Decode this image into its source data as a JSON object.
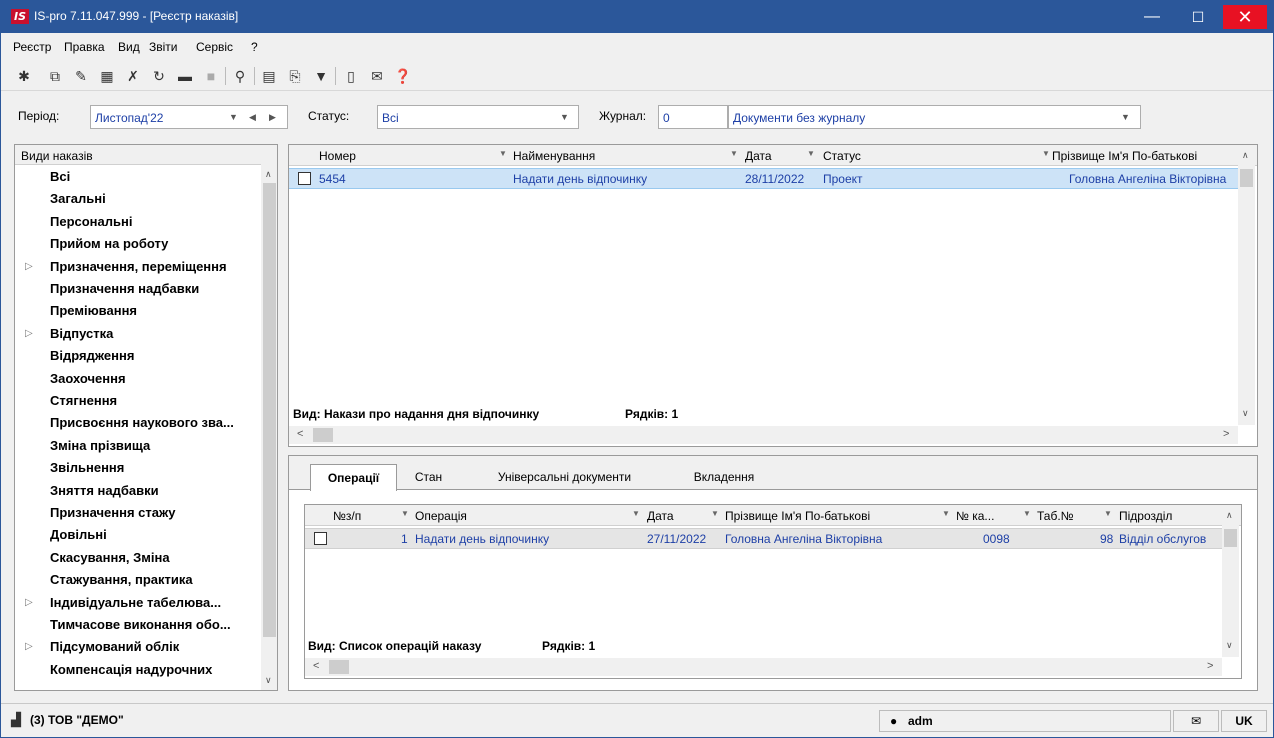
{
  "window": {
    "title": "IS-pro 7.11.047.999 - [Реєстр наказів]",
    "logo": "IS",
    "minimize": "—",
    "maximize": "☐",
    "close": "✕"
  },
  "menu": [
    "Реєстр",
    "Правка",
    "Вид",
    "Звіти",
    "Сервіс",
    "?"
  ],
  "toolbar_icons": [
    "new-doc-icon",
    "copy-doc-icon",
    "edit-doc-icon",
    "table-icon",
    "delete-doc-icon",
    "refresh-icon",
    "print-icon",
    "disabled-icon",
    "search-icon",
    "grid-icon",
    "export-icon",
    "filter-icon",
    "page-icon",
    "mail-icon",
    "help-icon"
  ],
  "filter": {
    "period_label": "Період:",
    "period_value": "Листопад'22",
    "status_label": "Статус:",
    "status_value": "Всі",
    "journal_label": "Журнал:",
    "journal_code": "0",
    "journal_value": "Документи без журналу"
  },
  "tree": {
    "header": "Види наказів",
    "items": [
      {
        "label": "Всі",
        "expandable": false
      },
      {
        "label": "Загальні",
        "expandable": false
      },
      {
        "label": "Персональні",
        "expandable": false
      },
      {
        "label": "Прийом на роботу",
        "expandable": false
      },
      {
        "label": "Призначення, переміщення",
        "expandable": true
      },
      {
        "label": "Призначення надбавки",
        "expandable": false
      },
      {
        "label": "Преміювання",
        "expandable": false
      },
      {
        "label": "Відпустка",
        "expandable": true
      },
      {
        "label": "Відрядження",
        "expandable": false
      },
      {
        "label": "Заохочення",
        "expandable": false
      },
      {
        "label": "Стягнення",
        "expandable": false
      },
      {
        "label": "Присвоєння наукового зва...",
        "expandable": false
      },
      {
        "label": "Зміна прізвища",
        "expandable": false
      },
      {
        "label": "Звільнення",
        "expandable": false
      },
      {
        "label": "Зняття надбавки",
        "expandable": false
      },
      {
        "label": "Призначення стажу",
        "expandable": false
      },
      {
        "label": "Довільні",
        "expandable": false
      },
      {
        "label": "Скасування, Зміна",
        "expandable": false
      },
      {
        "label": "Стажування, практика",
        "expandable": false
      },
      {
        "label": "Індивідуальне табелюва...",
        "expandable": true
      },
      {
        "label": "Тимчасове виконання обо...",
        "expandable": false
      },
      {
        "label": "Підсумований облік",
        "expandable": true
      },
      {
        "label": "Компенсація надурочних",
        "expandable": false
      }
    ]
  },
  "orders": {
    "columns": [
      "Номер",
      "Найменування",
      "Дата",
      "Статус",
      "Прізвище Ім'я По-батькові"
    ],
    "rows": [
      {
        "number": "5454",
        "name": "Надати день відпочинку",
        "date": "28/11/2022",
        "status": "Проект",
        "person": "Головна Ангеліна Вікторівна"
      }
    ],
    "footer_view": "Вид: Накази про надання дня відпочинку",
    "footer_rows": "Рядків: 1"
  },
  "tabs": [
    "Операції",
    "Стан",
    "Універсальні документи",
    "Вкладення"
  ],
  "operations": {
    "columns": [
      "№з/п",
      "Операція",
      "Дата",
      "Прізвище Ім'я По-батькові",
      "№ ка...",
      "Таб.№",
      "Підрозділ"
    ],
    "rows": [
      {
        "num": "1",
        "operation": "Надати день відпочинку",
        "date": "27/11/2022",
        "person": "Головна Ангеліна Вікторівна",
        "card": "0098",
        "tab": "98",
        "dept": "Відділ обслугов"
      }
    ],
    "footer_view": "Вид: Список операцій наказу",
    "footer_rows": "Рядків: 1"
  },
  "statusbar": {
    "org": "(3) ТОВ \"ДЕМО\"",
    "user": "adm",
    "lang": "UK"
  },
  "colors": {
    "titlebar": "#2b579a",
    "close": "#e81123",
    "value_text": "#1d3fa6",
    "selection": "#cde3f7"
  }
}
